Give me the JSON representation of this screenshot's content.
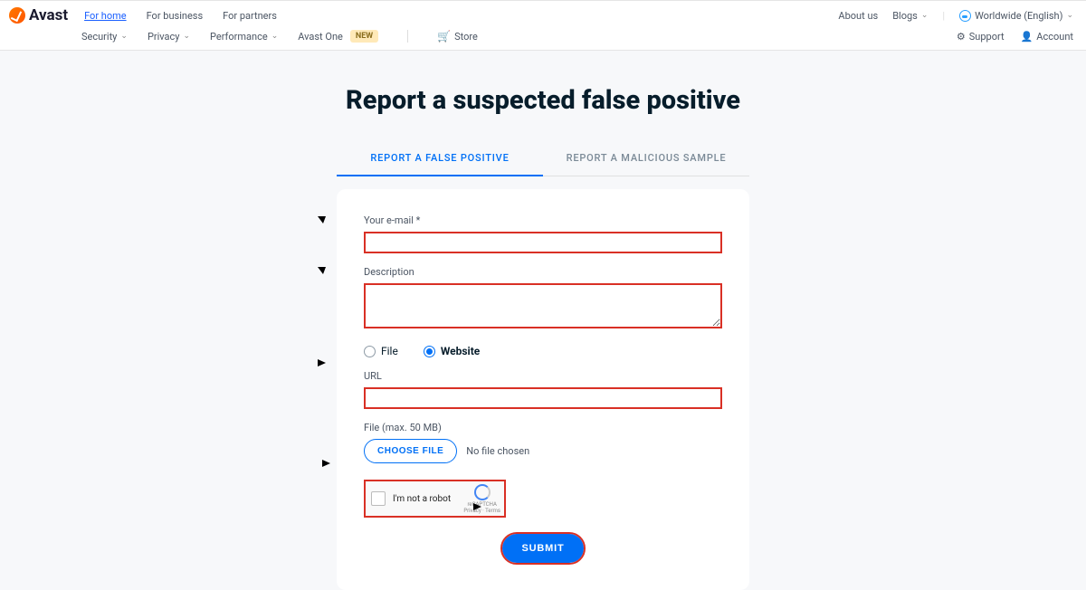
{
  "brand": "Avast",
  "nav1": {
    "home": "For home",
    "business": "For business",
    "partners": "For partners"
  },
  "nav_right1": {
    "about": "About us",
    "blogs": "Blogs",
    "region": "Worldwide (English)"
  },
  "nav2": {
    "security": "Security",
    "privacy": "Privacy",
    "performance": "Performance",
    "one": "Avast One",
    "new_badge": "NEW",
    "store": "Store"
  },
  "nav_right2": {
    "support": "Support",
    "account": "Account"
  },
  "page": {
    "title": "Report a suspected false positive"
  },
  "tabs": {
    "false_positive": "REPORT A FALSE POSITIVE",
    "malicious": "REPORT A MALICIOUS SAMPLE"
  },
  "form": {
    "email_label": "Your e-mail *",
    "desc_label": "Description",
    "radio_file": "File",
    "radio_website": "Website",
    "url_label": "URL",
    "file_label": "File (max. 50 MB)",
    "choose_file": "CHOOSE FILE",
    "no_file": "No file chosen",
    "recaptcha": "I'm not a robot",
    "recaptcha_brand": "reCAPTCHA",
    "recaptcha_terms": "Privacy · Terms",
    "submit": "SUBMIT"
  }
}
